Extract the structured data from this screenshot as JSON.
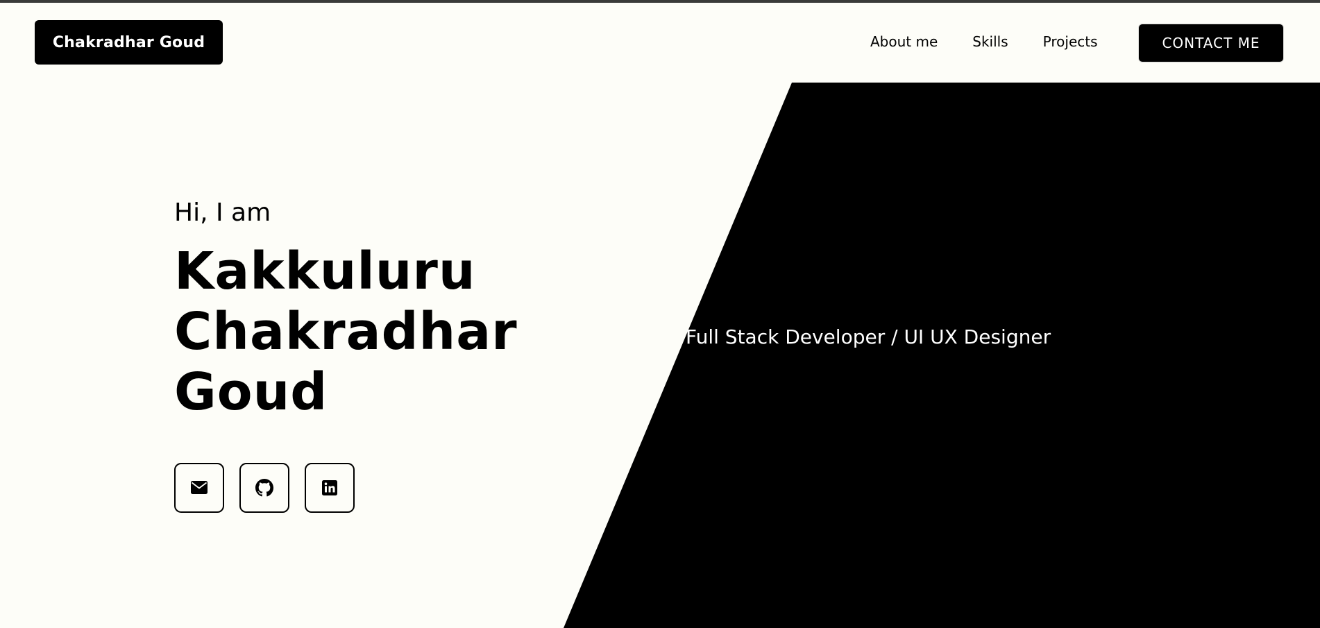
{
  "header": {
    "brand": "Chakradhar Goud",
    "nav": {
      "about": "About me",
      "skills": "Skills",
      "projects": "Projects"
    },
    "contact_label": "CONTACT ME"
  },
  "hero": {
    "greeting": "Hi, I am",
    "name_lines": [
      "Kakkuluru",
      "Chakradhar",
      "Goud"
    ],
    "tagline": "Full Stack Developer / UI UX Designer"
  },
  "socials": [
    {
      "icon": "envelope-icon"
    },
    {
      "icon": "github-icon"
    },
    {
      "icon": "linkedin-icon"
    }
  ],
  "colors": {
    "background": "#fdfdf8",
    "accent": "#000000",
    "text_on_dark": "#ffffff"
  }
}
